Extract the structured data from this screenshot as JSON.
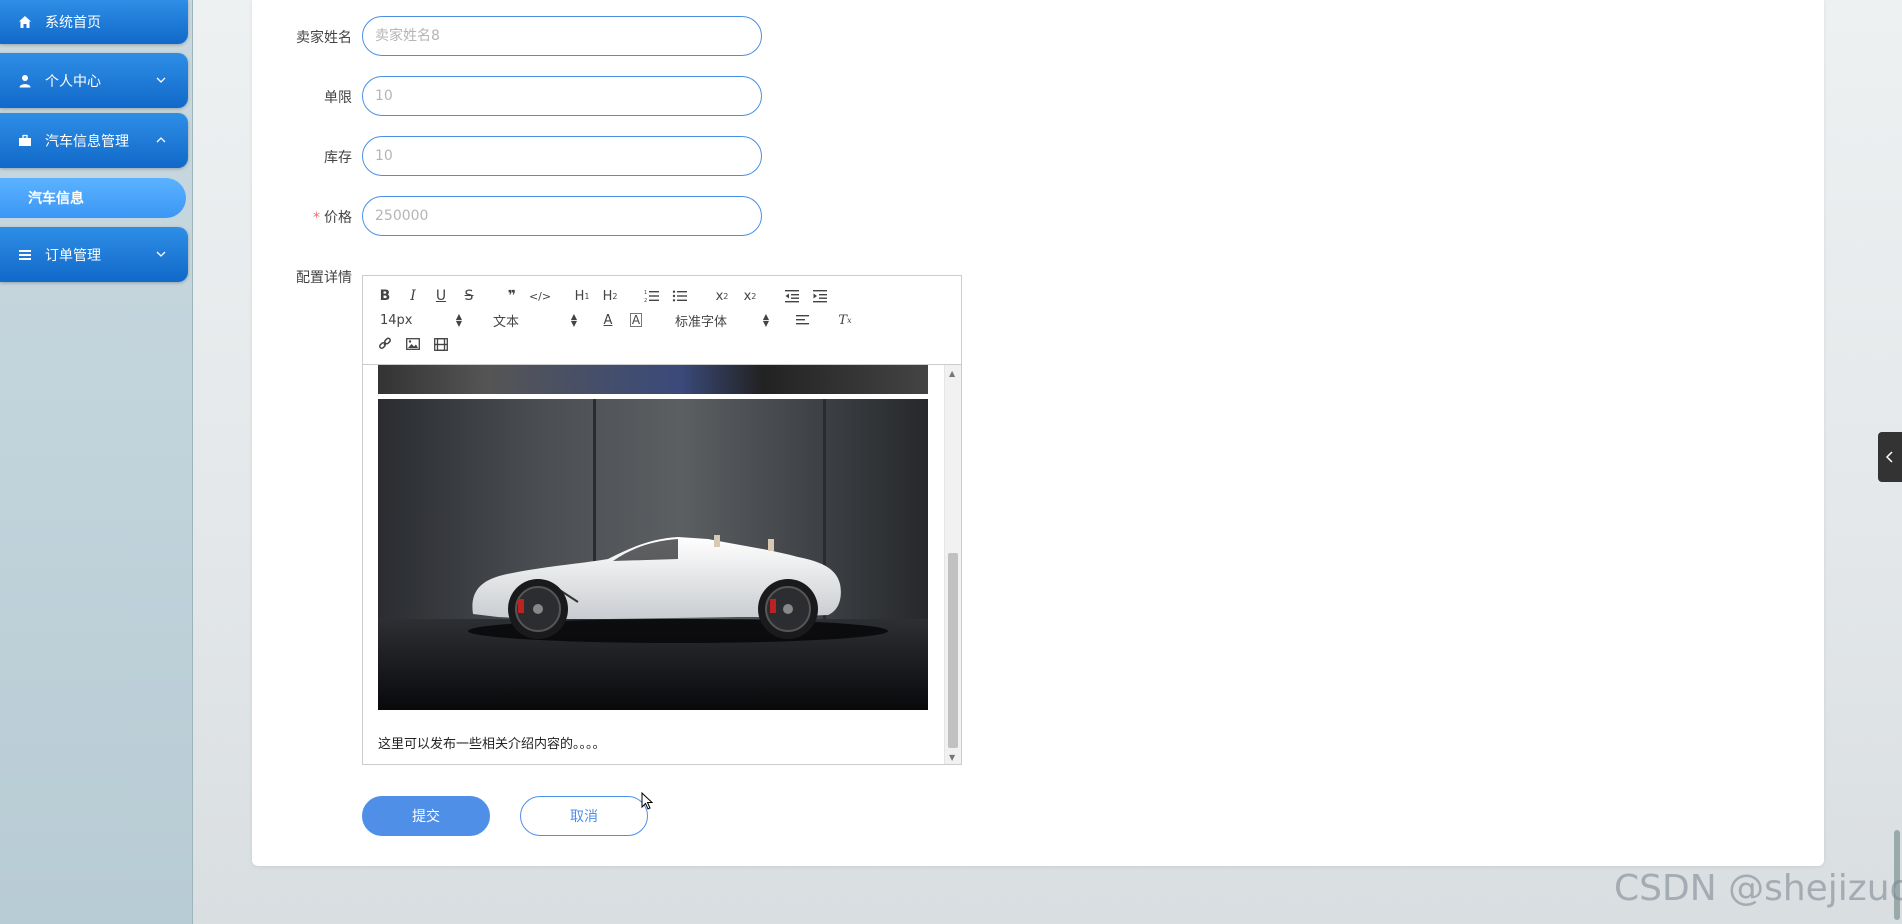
{
  "sidebar": {
    "items": [
      {
        "label": "系统首页",
        "icon": "home-icon",
        "expanded": null
      },
      {
        "label": "个人中心",
        "icon": "user-icon",
        "expanded": false
      },
      {
        "label": "汽车信息管理",
        "icon": "briefcase-icon",
        "expanded": true
      },
      {
        "label": "订单管理",
        "icon": "list-icon",
        "expanded": false
      }
    ],
    "sub_item": "汽车信息"
  },
  "form": {
    "seller_name": {
      "label": "卖家姓名",
      "placeholder": "卖家姓名8"
    },
    "limit": {
      "label": "单限",
      "placeholder": "10"
    },
    "stock": {
      "label": "库存",
      "placeholder": "10"
    },
    "price": {
      "label": "价格",
      "required_mark": "*",
      "placeholder": "250000"
    },
    "config": {
      "label": "配置详情"
    }
  },
  "editor": {
    "font_size": "14px",
    "block_format": "文本",
    "font_family": "标准字体",
    "intro_text": "这里可以发布一些相关介绍内容的。。。。"
  },
  "buttons": {
    "submit": "提交",
    "cancel": "取消"
  },
  "watermark": "CSDN @shejizuopin",
  "colors": {
    "sidebar_item": "#1a7ad8",
    "sidebar_sub": "#4aa6fb",
    "accent": "#4f8fe8",
    "required": "#f56c6c"
  }
}
